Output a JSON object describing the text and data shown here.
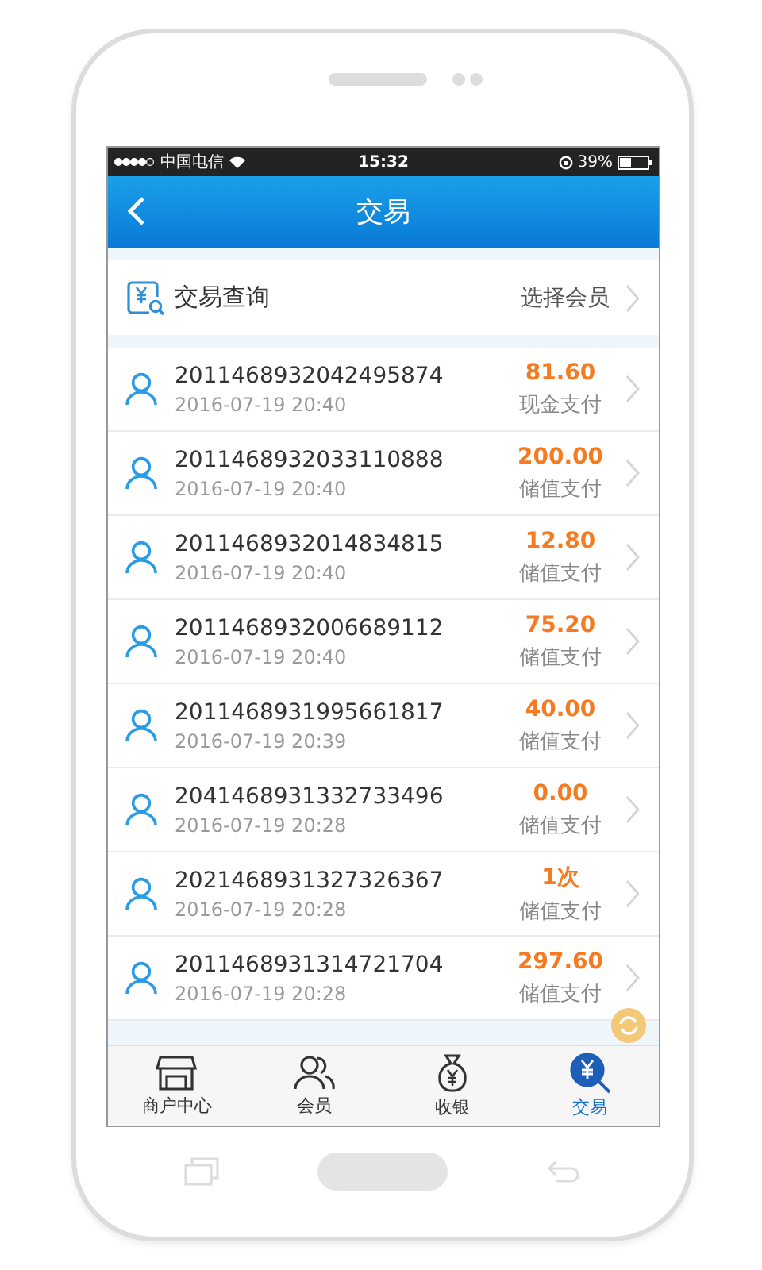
{
  "status_bar": {
    "carrier": "中国电信",
    "time": "15:32",
    "battery": "39%"
  },
  "header": {
    "title": "交易"
  },
  "query": {
    "title": "交易查询",
    "action": "选择会员"
  },
  "transactions": [
    {
      "number": "2011468932042495874",
      "time": "2016-07-19 20:40",
      "amount": "81.60",
      "method": "现金支付"
    },
    {
      "number": "2011468932033110888",
      "time": "2016-07-19 20:40",
      "amount": "200.00",
      "method": "储值支付"
    },
    {
      "number": "2011468932014834815",
      "time": "2016-07-19 20:40",
      "amount": "12.80",
      "method": "储值支付"
    },
    {
      "number": "2011468932006689112",
      "time": "2016-07-19 20:40",
      "amount": "75.20",
      "method": "储值支付"
    },
    {
      "number": "2011468931995661817",
      "time": "2016-07-19 20:39",
      "amount": "40.00",
      "method": "储值支付"
    },
    {
      "number": "2041468931332733496",
      "time": "2016-07-19 20:28",
      "amount": "0.00",
      "method": "储值支付"
    },
    {
      "number": "2021468931327326367",
      "time": "2016-07-19 20:28",
      "amount": "1次",
      "method": "储值支付"
    },
    {
      "number": "2011468931314721704",
      "time": "2016-07-19 20:28",
      "amount": "297.60",
      "method": "储值支付"
    }
  ],
  "tabs": [
    {
      "label": "商户中心",
      "selected": false
    },
    {
      "label": "会员",
      "selected": false
    },
    {
      "label": "收银",
      "selected": false
    },
    {
      "label": "交易",
      "selected": true
    }
  ]
}
